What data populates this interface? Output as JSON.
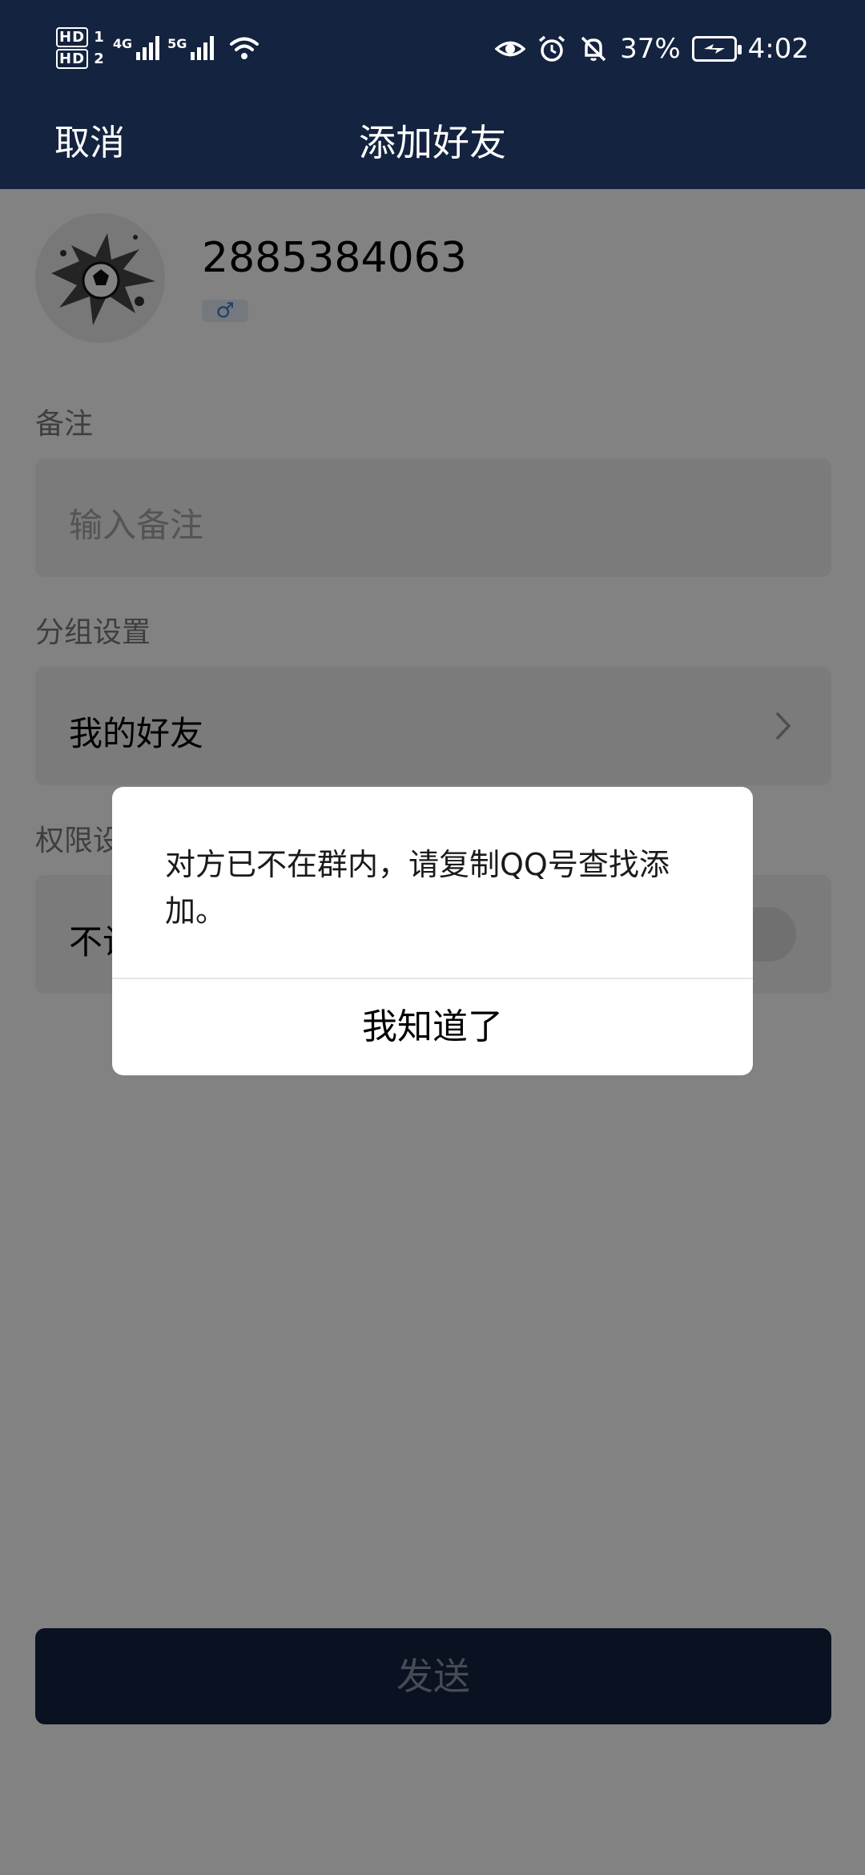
{
  "status_bar": {
    "hd1": "HD",
    "hd1_sim": "1",
    "hd2": "HD",
    "hd2_sim": "2",
    "net1": "4G",
    "net2": "5G",
    "battery_percent": "37%",
    "time": "4:02",
    "icons": [
      "eye-icon",
      "alarm-icon",
      "mute-bell-icon",
      "battery-charging-icon",
      "wifi-icon",
      "signal-icon"
    ]
  },
  "header": {
    "cancel_label": "取消",
    "title": "添加好友"
  },
  "profile": {
    "qq_number": "2885384063",
    "gender_symbol": "♂"
  },
  "remark": {
    "label": "备注",
    "placeholder": "输入备注"
  },
  "group": {
    "label": "分组设置",
    "value": "我的好友"
  },
  "permission": {
    "label_visible": "权限设",
    "row_visible": "不让"
  },
  "send_label": "发送",
  "dialog": {
    "message": "对方已不在群内，请复制QQ号查找添加。",
    "ok_label": "我知道了"
  },
  "colors": {
    "header_bg": "#14233f",
    "accent_gender": "#3b7bd4"
  }
}
